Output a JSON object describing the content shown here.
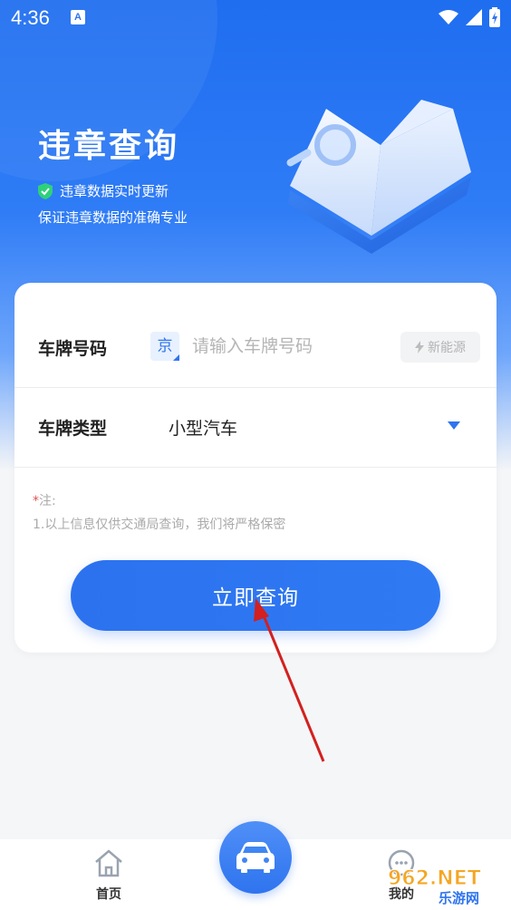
{
  "status_bar": {
    "time": "4:36",
    "notif_glyph": "A"
  },
  "hero": {
    "title": "违章查询",
    "line1": "违章数据实时更新",
    "line2": "保证违章数据的准确专业"
  },
  "form": {
    "plate_label": "车牌号码",
    "province": "京",
    "plate_placeholder": "请输入车牌号码",
    "plate_value": "",
    "new_energy_label": "新能源",
    "type_label": "车牌类型",
    "type_value": "小型汽车",
    "note_star": "*",
    "note_title": "注:",
    "note_text": "1.以上信息仅供交通局查询，我们将严格保密",
    "submit_label": "立即查询"
  },
  "tabbar": {
    "home_label": "首页",
    "mine_label": "我的"
  },
  "watermark": {
    "brand": "962.NET",
    "sub": "乐游网"
  },
  "colors": {
    "primary": "#2f74ef",
    "annotation": "#d32020"
  }
}
